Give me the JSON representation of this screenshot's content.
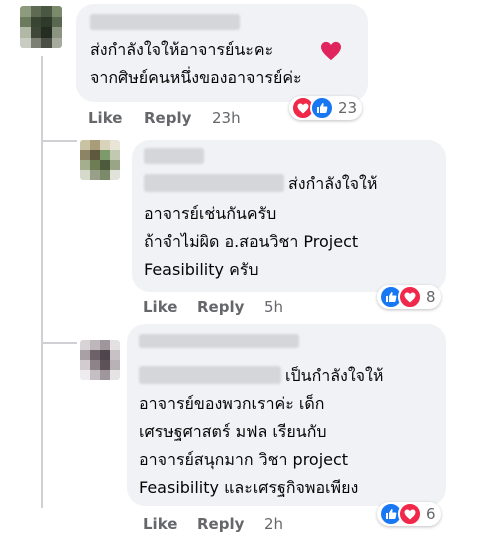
{
  "colors": {
    "bubble": "#f0f2f5",
    "action_text": "#65676b",
    "like_blue": "#1877f2",
    "love_red": "#f02849"
  },
  "comments": [
    {
      "lines": [
        "ส่งกำลังใจให้อาจารย์นะคะ",
        "จากศิษย์คนหนึ่งของอาจารย์ค่ะ"
      ],
      "emoji": "red-heart",
      "reactions": {
        "icons": [
          "love-icon",
          "like-icon"
        ],
        "count": "23"
      },
      "actions": {
        "like": "Like",
        "reply": "Reply",
        "time": "23h"
      }
    },
    {
      "lines": [
        "ส่งกำลังใจให้",
        "อาจารย์เช่นกันครับ",
        "ถ้าจำไม่ผิด อ.สอนวิชา Project",
        "Feasibility ครับ"
      ],
      "reactions": {
        "icons": [
          "like-icon",
          "love-icon"
        ],
        "count": "8"
      },
      "actions": {
        "like": "Like",
        "reply": "Reply",
        "time": "5h"
      }
    },
    {
      "lines": [
        "เป็นกำลังใจให้",
        "อาจารย์ของพวกเราค่ะ เด็ก",
        "เศรษฐศาสตร์ มฟล เรียนกับ",
        "อาจารย์สนุกมาก วิชา project",
        "Feasibility และเศรฐกิจพอเพียง"
      ],
      "reactions": {
        "icons": [
          "like-icon",
          "love-icon"
        ],
        "count": "6"
      },
      "actions": {
        "like": "Like",
        "reply": "Reply",
        "time": "2h"
      }
    }
  ]
}
